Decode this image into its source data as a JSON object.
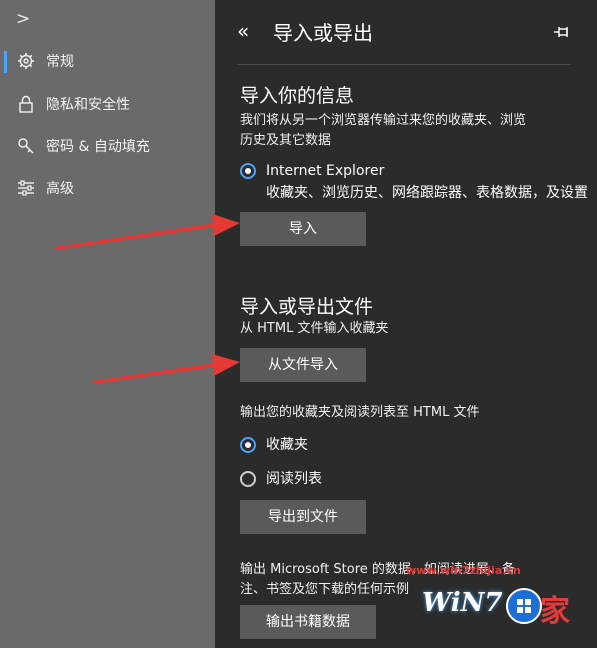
{
  "sidebar": {
    "items": [
      {
        "label": "常规",
        "icon": "gear-icon",
        "active": true
      },
      {
        "label": "隐私和安全性",
        "icon": "lock-icon",
        "active": false
      },
      {
        "label": "密码 & 自动填充",
        "icon": "key-icon",
        "active": false
      },
      {
        "label": "高级",
        "icon": "sliders-icon",
        "active": false
      }
    ]
  },
  "header": {
    "back_glyph": "«",
    "title": "导入或导出"
  },
  "import_info": {
    "heading": "导入你的信息",
    "desc_line1": "我们将从另一个浏览器传输过来您的收藏夹、浏览",
    "desc_line2": "历史及其它数据",
    "option_label": "Internet Explorer",
    "option_desc": "收藏夹、浏览历史、网络跟踪器、表格数据，及设置",
    "import_button": "导入"
  },
  "import_export_file": {
    "heading": "导入或导出文件",
    "desc": "从 HTML 文件输入收藏夹",
    "import_from_file_button": "从文件导入",
    "export_desc": "输出您的收藏夹及阅读列表至 HTML 文件",
    "options": [
      {
        "label": "收藏夹",
        "checked": true
      },
      {
        "label": "阅读列表",
        "checked": false
      }
    ],
    "export_button": "导出到文件"
  },
  "store": {
    "desc_line1": "输出 Microsoft Store 的数据，如阅读进展、备",
    "desc_line2": "注、书签及您下载的任何示例",
    "export_books_button": "输出书籍数据"
  },
  "watermark": {
    "url": "www.win7zhijia.cn",
    "brand": "WiN7",
    "char": "家"
  },
  "colors": {
    "sidebar_bg": "#6a6a6a",
    "content_bg": "#2b2b2b",
    "accent": "#4aa3ff",
    "button_bg": "#5a5a5a",
    "arrow": "#e53935"
  }
}
